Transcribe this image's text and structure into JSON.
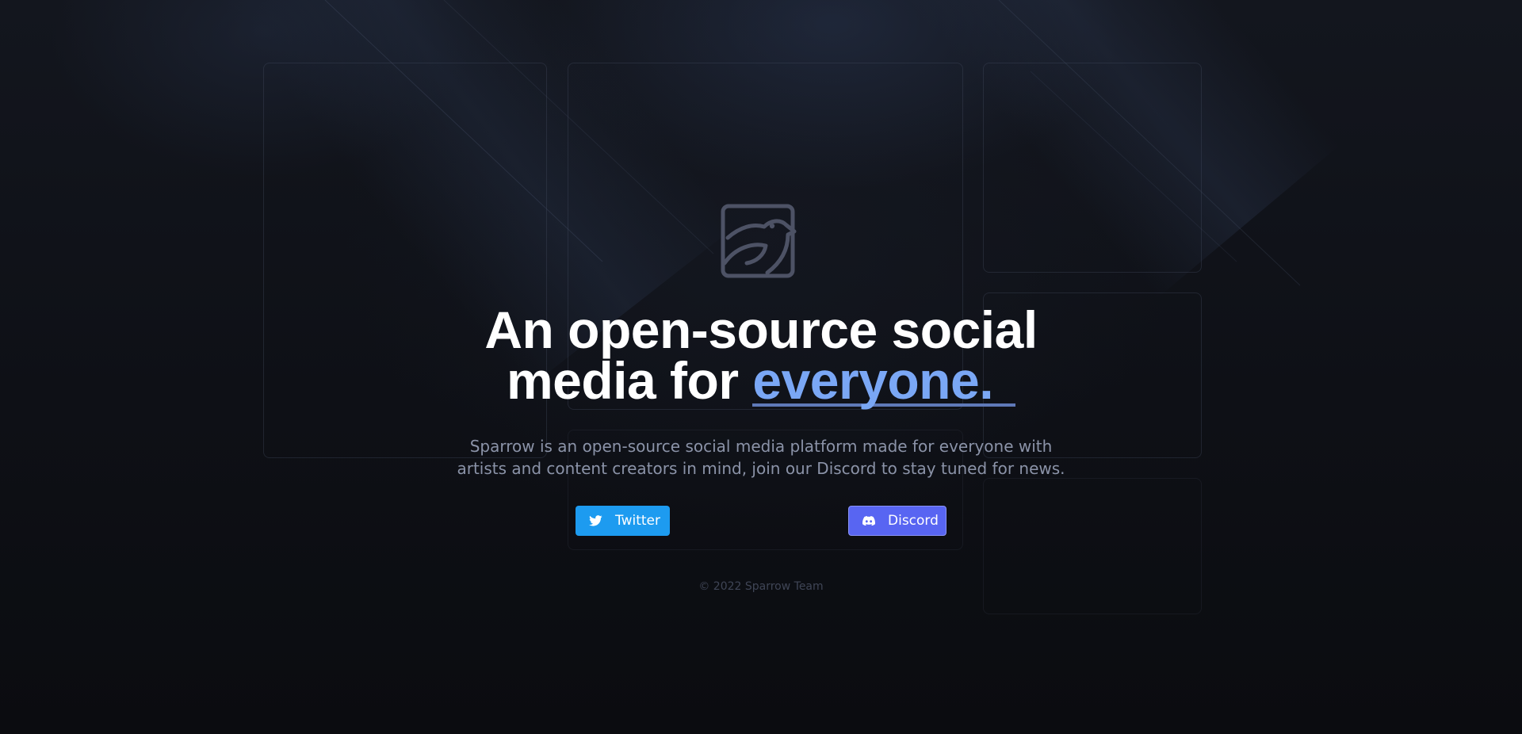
{
  "hero": {
    "headline_line1": "An open-source social",
    "headline_line2_prefix": "media for ",
    "headline_accent": "everyone.",
    "subtitle_line1": "Sparrow is an open-source social media platform made for everyone with",
    "subtitle_line2": "artists and content creators in mind, join our Discord to stay tuned for news."
  },
  "buttons": {
    "twitter_label": "Twitter",
    "discord_label": "Discord"
  },
  "footer": {
    "copyright": "© 2022 Sparrow Team"
  },
  "icons": {
    "logo": "sparrow-bird-logo",
    "twitter": "twitter-bird-icon",
    "discord": "discord-icon"
  },
  "colors": {
    "background": "#0d0f14",
    "headline": "#ffffff",
    "accent": "#7aa7f5",
    "accent_underline": "#5f79b8",
    "subtitle": "#8b93a8",
    "twitter": "#1d9bf0",
    "discord": "#5865f2",
    "footer": "#3f4556",
    "logo_stroke": "#4d5265"
  }
}
